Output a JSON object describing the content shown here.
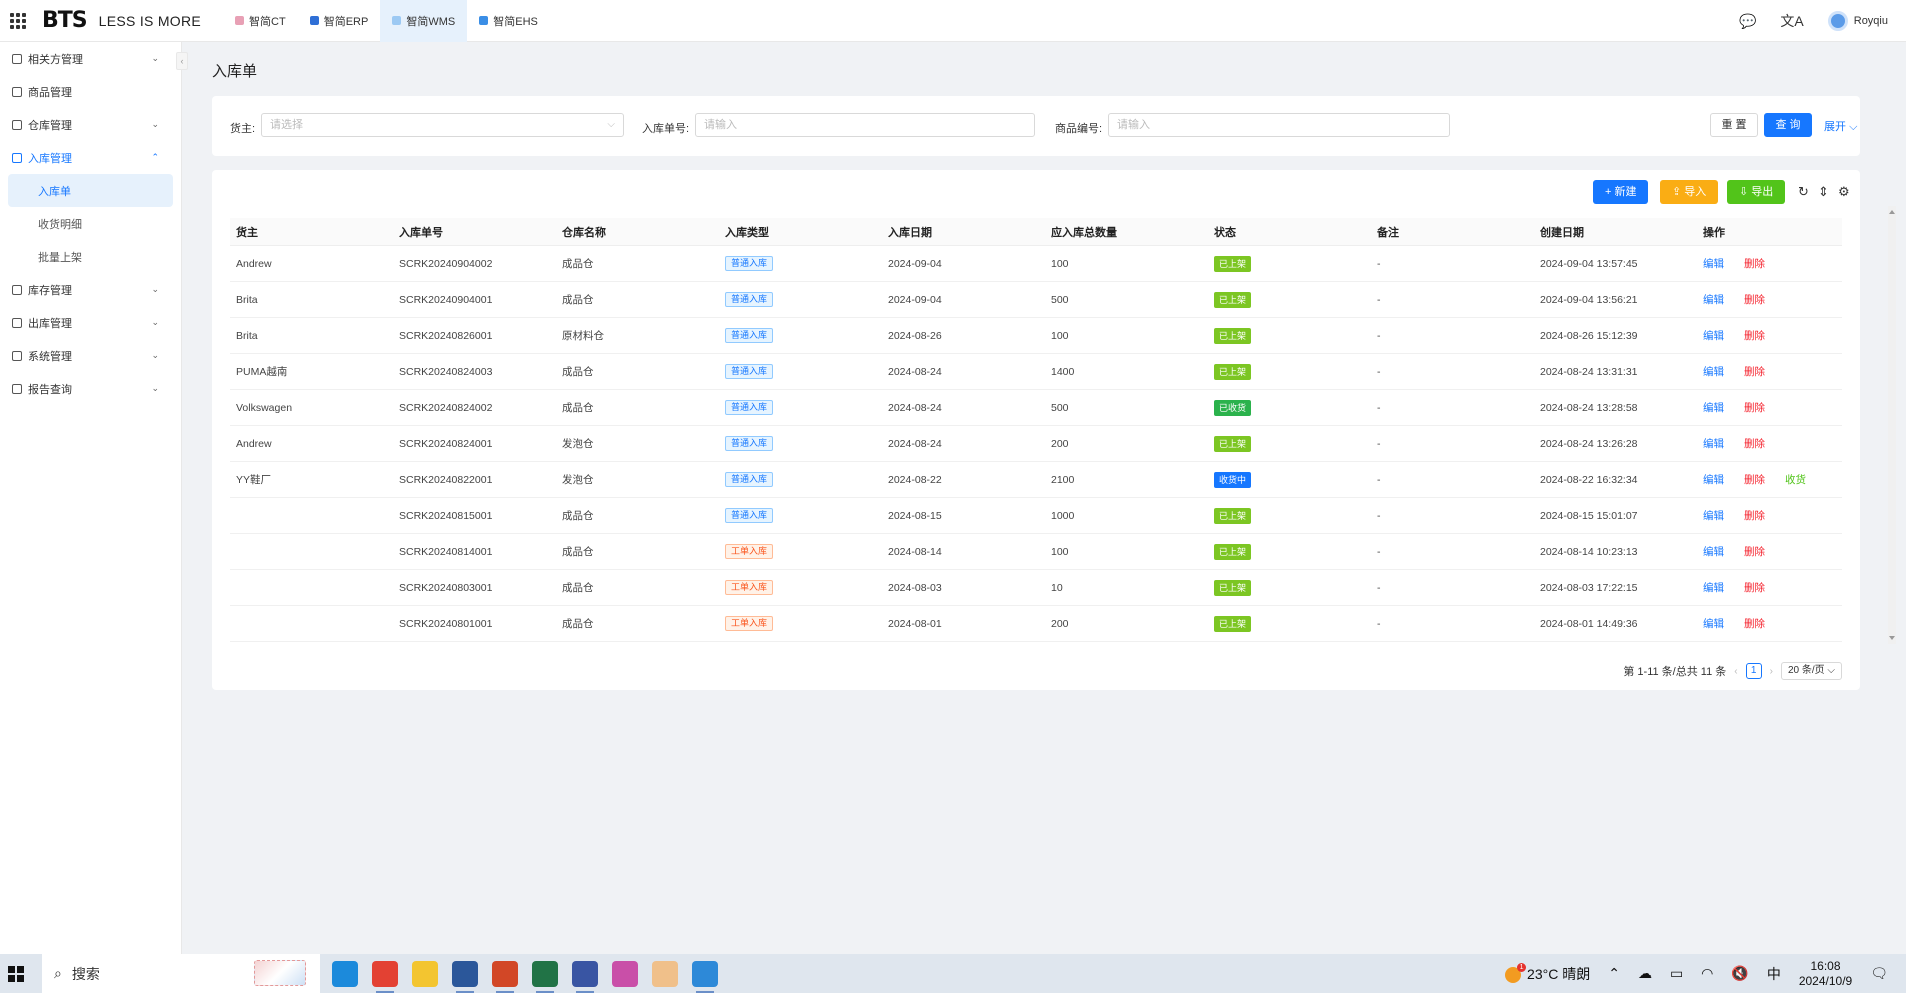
{
  "brand": {
    "logo": "BTS",
    "slogan": "LESS IS MORE"
  },
  "systabs": [
    {
      "label": "智简CT",
      "color": "#e8a0b5",
      "active": false
    },
    {
      "label": "智简ERP",
      "color": "#2f6fd6",
      "active": false
    },
    {
      "label": "智简WMS",
      "color": "#9cc9f3",
      "active": true
    },
    {
      "label": "智简EHS",
      "color": "#3a8ee6",
      "active": false
    }
  ],
  "topright": {
    "wechat_icon": "wechat-icon",
    "translate_icon": "translate-icon",
    "username": "Royqiu"
  },
  "sidebar": {
    "menu": [
      {
        "label": "相关方管理",
        "expandable": true
      },
      {
        "label": "商品管理",
        "expandable": false
      },
      {
        "label": "仓库管理",
        "expandable": true
      },
      {
        "label": "入库管理",
        "expandable": true,
        "open": true,
        "children": [
          {
            "label": "入库单",
            "active": true
          },
          {
            "label": "收货明细",
            "active": false
          },
          {
            "label": "批量上架",
            "active": false
          }
        ]
      },
      {
        "label": "库存管理",
        "expandable": true
      },
      {
        "label": "出库管理",
        "expandable": true
      },
      {
        "label": "系统管理",
        "expandable": true
      },
      {
        "label": "报告查询",
        "expandable": true
      }
    ]
  },
  "page": {
    "title": "入库单"
  },
  "filters": {
    "owner_label": "货主:",
    "owner_placeholder": "请选择",
    "order_label": "入库单号:",
    "order_placeholder": "请输入",
    "product_label": "商品编号:",
    "product_placeholder": "请输入",
    "reset": "重 置",
    "search": "查 询",
    "expand": "展开"
  },
  "toolbar": {
    "new": "+ 新建",
    "import": "导入",
    "export": "导出"
  },
  "table": {
    "columns": [
      "货主",
      "入库单号",
      "仓库名称",
      "入库类型",
      "入库日期",
      "应入库总数量",
      "状态",
      "备注",
      "创建日期",
      "操作"
    ],
    "rows": [
      {
        "owner": "Andrew",
        "no": "SCRK20240904002",
        "wh": "成品仓",
        "type": "普通入库",
        "type_color": "blue",
        "date": "2024-09-04",
        "qty": "100",
        "status": "已上架",
        "status_color": "#7cc623",
        "note": "-",
        "created": "2024-09-04 13:57:45",
        "actions": [
          "编辑",
          "删除"
        ]
      },
      {
        "owner": "Brita",
        "no": "SCRK20240904001",
        "wh": "成品仓",
        "type": "普通入库",
        "type_color": "blue",
        "date": "2024-09-04",
        "qty": "500",
        "status": "已上架",
        "status_color": "#7cc623",
        "note": "-",
        "created": "2024-09-04 13:56:21",
        "actions": [
          "编辑",
          "删除"
        ]
      },
      {
        "owner": "Brita",
        "no": "SCRK20240826001",
        "wh": "原材料仓",
        "type": "普通入库",
        "type_color": "blue",
        "date": "2024-08-26",
        "qty": "100",
        "status": "已上架",
        "status_color": "#7cc623",
        "note": "-",
        "created": "2024-08-26 15:12:39",
        "actions": [
          "编辑",
          "删除"
        ]
      },
      {
        "owner": "PUMA越南",
        "no": "SCRK20240824003",
        "wh": "成品仓",
        "type": "普通入库",
        "type_color": "blue",
        "date": "2024-08-24",
        "qty": "1400",
        "status": "已上架",
        "status_color": "#7cc623",
        "note": "-",
        "created": "2024-08-24 13:31:31",
        "actions": [
          "编辑",
          "删除"
        ]
      },
      {
        "owner": "Volkswagen",
        "no": "SCRK20240824002",
        "wh": "成品仓",
        "type": "普通入库",
        "type_color": "blue",
        "date": "2024-08-24",
        "qty": "500",
        "status": "已收货",
        "status_color": "#2bb24c",
        "note": "-",
        "created": "2024-08-24 13:28:58",
        "actions": [
          "编辑",
          "删除"
        ]
      },
      {
        "owner": "Andrew",
        "no": "SCRK20240824001",
        "wh": "发泡仓",
        "type": "普通入库",
        "type_color": "blue",
        "date": "2024-08-24",
        "qty": "200",
        "status": "已上架",
        "status_color": "#7cc623",
        "note": "-",
        "created": "2024-08-24 13:26:28",
        "actions": [
          "编辑",
          "删除"
        ]
      },
      {
        "owner": "YY鞋厂",
        "no": "SCRK20240822001",
        "wh": "发泡仓",
        "type": "普通入库",
        "type_color": "blue",
        "date": "2024-08-22",
        "qty": "2100",
        "status": "收货中",
        "status_color": "#1677ff",
        "note": "-",
        "created": "2024-08-22 16:32:34",
        "actions": [
          "编辑",
          "删除",
          "收货"
        ]
      },
      {
        "owner": "",
        "no": "SCRK20240815001",
        "wh": "成品仓",
        "type": "普通入库",
        "type_color": "blue",
        "date": "2024-08-15",
        "qty": "1000",
        "status": "已上架",
        "status_color": "#7cc623",
        "note": "-",
        "created": "2024-08-15 15:01:07",
        "actions": [
          "编辑",
          "删除"
        ]
      },
      {
        "owner": "",
        "no": "SCRK20240814001",
        "wh": "成品仓",
        "type": "工单入库",
        "type_color": "orange",
        "date": "2024-08-14",
        "qty": "100",
        "status": "已上架",
        "status_color": "#7cc623",
        "note": "-",
        "created": "2024-08-14 10:23:13",
        "actions": [
          "编辑",
          "删除"
        ]
      },
      {
        "owner": "",
        "no": "SCRK20240803001",
        "wh": "成品仓",
        "type": "工单入库",
        "type_color": "orange",
        "date": "2024-08-03",
        "qty": "10",
        "status": "已上架",
        "status_color": "#7cc623",
        "note": "-",
        "created": "2024-08-03 17:22:15",
        "actions": [
          "编辑",
          "删除"
        ]
      },
      {
        "owner": "",
        "no": "SCRK20240801001",
        "wh": "成品仓",
        "type": "工单入库",
        "type_color": "orange",
        "date": "2024-08-01",
        "qty": "200",
        "status": "已上架",
        "status_color": "#7cc623",
        "note": "-",
        "created": "2024-08-01 14:49:36",
        "actions": [
          "编辑",
          "删除"
        ]
      }
    ]
  },
  "pagination": {
    "summary": "第 1-11 条/总共 11 条",
    "current": "1",
    "page_size": "20 条/页"
  },
  "taskbar": {
    "search_label": "搜索",
    "apps": [
      {
        "name": "edge-icon",
        "color": "#1c8adb",
        "running": false
      },
      {
        "name": "chrome-icon",
        "color": "#e34133",
        "running": true
      },
      {
        "name": "file-explorer-icon",
        "color": "#f3c530",
        "running": false
      },
      {
        "name": "word-icon",
        "color": "#2b579a",
        "running": true
      },
      {
        "name": "powerpoint-icon",
        "color": "#d24726",
        "running": true
      },
      {
        "name": "excel-icon",
        "color": "#217346",
        "running": true
      },
      {
        "name": "visio-icon",
        "color": "#3955a3",
        "running": true
      },
      {
        "name": "snipping-tool-icon",
        "color": "#c94fa8",
        "running": false
      },
      {
        "name": "bts-app-icon",
        "color": "#f0c08a",
        "running": false
      },
      {
        "name": "photos-icon",
        "color": "#2d89d8",
        "running": true
      }
    ],
    "weather_badge": "1",
    "weather": "23°C 晴朗",
    "ime": "中",
    "time": "16:08",
    "date": "2024/10/9"
  }
}
